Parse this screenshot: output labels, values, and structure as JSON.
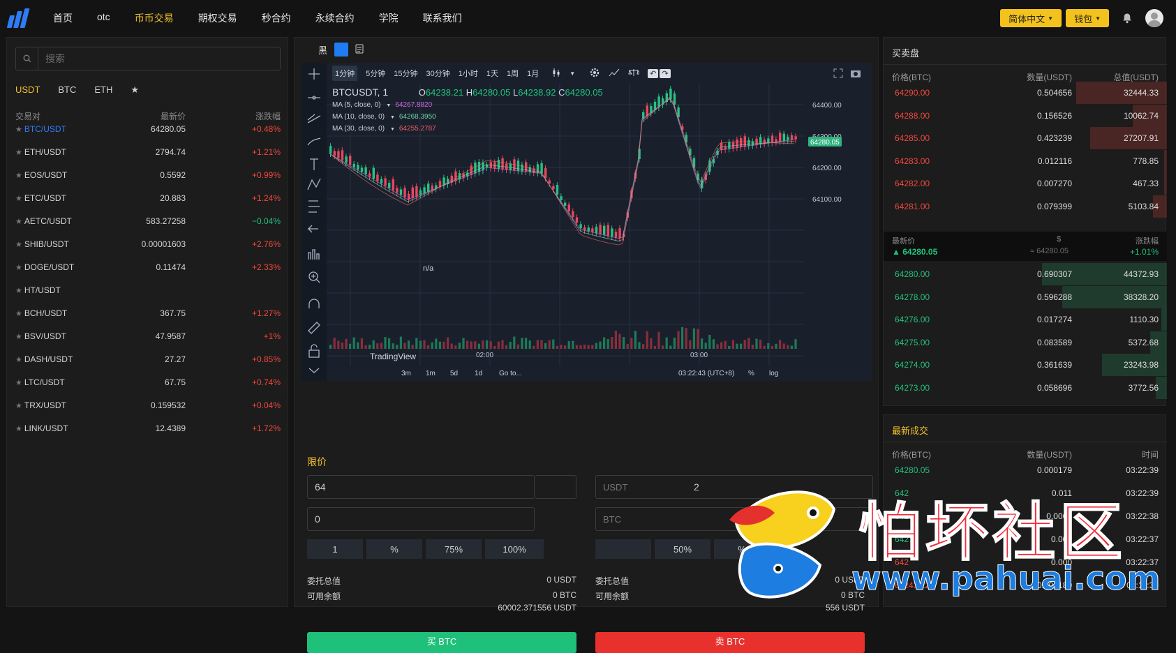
{
  "nav": {
    "items": [
      "首页",
      "otc",
      "币币交易",
      "期权交易",
      "秒合约",
      "永续合约",
      "学院",
      "联系我们"
    ],
    "active_index": 2,
    "lang_label": "简体中文",
    "wallet_label": "钱包"
  },
  "market": {
    "search_placeholder": "搜索",
    "tabs": [
      "USDT",
      "BTC",
      "ETH",
      "★"
    ],
    "headers": {
      "pair": "交易对",
      "price": "最新价",
      "change": "涨跌幅"
    },
    "rows": [
      {
        "pair": "BTC/USDT",
        "price": "64280.05",
        "change": "+0.48%",
        "dir": "up",
        "selected": true
      },
      {
        "pair": "ETH/USDT",
        "price": "2794.74",
        "change": "+1.21%",
        "dir": "up"
      },
      {
        "pair": "EOS/USDT",
        "price": "0.5592",
        "change": "+0.99%",
        "dir": "up"
      },
      {
        "pair": "ETC/USDT",
        "price": "20.883",
        "change": "+1.24%",
        "dir": "up"
      },
      {
        "pair": "AETC/USDT",
        "price": "583.27258",
        "change": "−0.04%",
        "dir": "down"
      },
      {
        "pair": "SHIB/USDT",
        "price": "0.00001603",
        "change": "+2.76%",
        "dir": "up"
      },
      {
        "pair": "DOGE/USDT",
        "price": "0.11474",
        "change": "+2.33%",
        "dir": "up"
      },
      {
        "pair": "HT/USDT",
        "price": "",
        "change": "",
        "dir": "up"
      },
      {
        "pair": "BCH/USDT",
        "price": "367.75",
        "change": "+1.27%",
        "dir": "up"
      },
      {
        "pair": "BSV/USDT",
        "price": "47.9587",
        "change": "+1%",
        "dir": "up"
      },
      {
        "pair": "DASH/USDT",
        "price": "27.27",
        "change": "+0.85%",
        "dir": "up"
      },
      {
        "pair": "LTC/USDT",
        "price": "67.75",
        "change": "+0.74%",
        "dir": "up"
      },
      {
        "pair": "TRX/USDT",
        "price": "0.159532",
        "change": "+0.04%",
        "dir": "up"
      },
      {
        "pair": "LINK/USDT",
        "price": "12.4389",
        "change": "+1.72%",
        "dir": "up"
      }
    ]
  },
  "chart": {
    "theme_label": "黑",
    "intervals": [
      "1分钟",
      "5分钟",
      "15分钟",
      "30分钟",
      "1小时",
      "1天",
      "1周",
      "1月"
    ],
    "selected_interval": "1分钟",
    "symbol": "BTCUSDT, 1",
    "ohlc": {
      "o": "O",
      "o_val": "64238.21",
      "h": "H",
      "h_val": "64280.05",
      "l": "L",
      "l_val": "64238.92",
      "c": "C",
      "c_val": "64280.05"
    },
    "ma": [
      {
        "label": "MA (5, close, 0)",
        "value": "64267.8820",
        "color": "#d066e0"
      },
      {
        "label": "MA (10, close, 0)",
        "value": "64268.3950",
        "color": "#6fd0a4"
      },
      {
        "label": "MA (30, close, 0)",
        "value": "64255.2787",
        "color": "#f0616b"
      }
    ],
    "price_axis": [
      "64400.00",
      "64300.00",
      "64200.00",
      "64100.00"
    ],
    "last_price_tag": "64280.05",
    "time_axis": [
      "02:00",
      "03:00"
    ],
    "volume_label": "n/a",
    "watermark": "TradingView",
    "bottom_ranges": [
      "3m",
      "1m",
      "5d",
      "1d",
      "Go to..."
    ],
    "clock": "03:22:43 (UTC+8)",
    "bottom_right": [
      "%",
      "log"
    ]
  },
  "order": {
    "type_title": "限价",
    "price_value": "64",
    "price_unit": "USDT",
    "amount_value": "0",
    "amount_unit": "BTC",
    "sell_price_fragment": "2",
    "pct_buttons_left": [
      "1",
      "%",
      "75%",
      "100%"
    ],
    "pct_buttons_right": [
      "50%",
      "%"
    ],
    "buy_info": {
      "total_label": "委托总值",
      "total": "0 USDT",
      "avail_label": "可用余额",
      "avail_btc": "0 BTC",
      "avail_usdt": "60002.371556 USDT"
    },
    "sell_info": {
      "total_label": "委托总值",
      "total": "0 USDT",
      "avail_label": "可用余额",
      "avail_btc": "0 BTC",
      "avail_usdt": "556 USDT"
    },
    "buy_label": "买 BTC",
    "sell_label": "卖 BTC"
  },
  "orderbook": {
    "title": "买卖盘",
    "headers": {
      "price": "价格(BTC)",
      "qty": "数量(USDT)",
      "total": "总值(USDT)"
    },
    "asks": [
      {
        "price": "64290.00",
        "qty": "0.504656",
        "total": "32444.33",
        "depth": 0.32
      },
      {
        "price": "64288.00",
        "qty": "0.156526",
        "total": "10062.74",
        "depth": 0.12
      },
      {
        "price": "64285.00",
        "qty": "0.423239",
        "total": "27207.91",
        "depth": 0.27
      },
      {
        "price": "64283.00",
        "qty": "0.012116",
        "total": "778.85",
        "depth": 0.01
      },
      {
        "price": "64282.00",
        "qty": "0.007270",
        "total": "467.33",
        "depth": 0.01
      },
      {
        "price": "64281.00",
        "qty": "0.079399",
        "total": "5103.84",
        "depth": 0.05
      }
    ],
    "mid": {
      "last_label": "最新价",
      "usd_label": "$",
      "chg_label": "涨跌幅",
      "last": "64280.05",
      "usd": "≈ 64280.05",
      "chg": "+1.01%"
    },
    "bids": [
      {
        "price": "64280.00",
        "qty": "0.690307",
        "total": "44372.93",
        "depth": 0.44
      },
      {
        "price": "64278.00",
        "qty": "0.596288",
        "total": "38328.20",
        "depth": 0.37
      },
      {
        "price": "64276.00",
        "qty": "0.017274",
        "total": "1110.30",
        "depth": 0.02
      },
      {
        "price": "64275.00",
        "qty": "0.083589",
        "total": "5372.68",
        "depth": 0.06
      },
      {
        "price": "64274.00",
        "qty": "0.361639",
        "total": "23243.98",
        "depth": 0.23
      },
      {
        "price": "64273.00",
        "qty": "0.058696",
        "total": "3772.56",
        "depth": 0.04
      }
    ]
  },
  "trades": {
    "title": "最新成交",
    "headers": {
      "price": "价格(BTC)",
      "qty": "数量(USDT)",
      "time": "时间"
    },
    "rows": [
      {
        "price": "64280.05",
        "qty": "0.000179",
        "time": "03:22:39",
        "dir": "up"
      },
      {
        "price": "642",
        "qty": "0.011",
        "time": "03:22:39",
        "dir": "up"
      },
      {
        "price": "6427",
        "qty": "0.0065",
        "time": "03:22:38",
        "dir": "up"
      },
      {
        "price": "6427",
        "qty": "0.000",
        "time": "03:22:37",
        "dir": "up"
      },
      {
        "price": "642",
        "qty": "0.000",
        "time": "03:22:37",
        "dir": "down"
      },
      {
        "price": "64243.22",
        "qty": "0.000180",
        "time": "03:11:30",
        "dir": "down"
      }
    ]
  },
  "watermark": {
    "text": "怕坏社区",
    "url": "www.pahuai.com"
  },
  "colors": {
    "up": "#21c27c",
    "down": "#f0473e",
    "accent": "#f0c12a",
    "blue": "#2f7cf6"
  }
}
